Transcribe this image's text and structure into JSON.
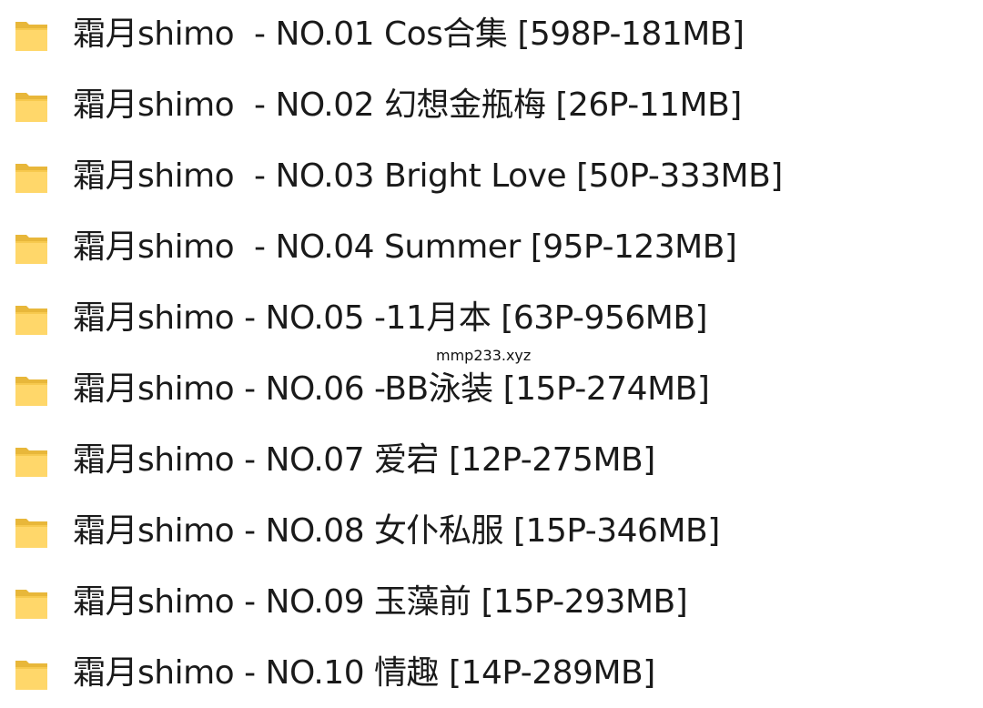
{
  "folders": [
    {
      "name": "霜月shimo  - NO.01 Cos合集 [598P-181MB]",
      "icon": "folder-icon"
    },
    {
      "name": "霜月shimo  - NO.02 幻想金瓶梅 [26P-11MB]",
      "icon": "folder-icon"
    },
    {
      "name": "霜月shimo  - NO.03 Bright Love [50P-333MB]",
      "icon": "folder-icon"
    },
    {
      "name": "霜月shimo  - NO.04 Summer [95P-123MB]",
      "icon": "folder-icon"
    },
    {
      "name": "霜月shimo - NO.05 -11月本 [63P-956MB]",
      "icon": "folder-icon"
    },
    {
      "name": "霜月shimo - NO.06 -BB泳装 [15P-274MB]",
      "icon": "folder-icon"
    },
    {
      "name": "霜月shimo - NO.07 爱宕 [12P-275MB]",
      "icon": "folder-icon"
    },
    {
      "name": "霜月shimo - NO.08 女仆私服 [15P-346MB]",
      "icon": "folder-icon"
    },
    {
      "name": "霜月shimo - NO.09 玉藻前 [15P-293MB]",
      "icon": "folder-icon"
    },
    {
      "name": "霜月shimo - NO.10 情趣 [14P-289MB]",
      "icon": "folder-icon"
    }
  ],
  "watermark": "mmp233.xyz",
  "colors": {
    "folder_back": "#e8b73a",
    "folder_front": "#ffd76a",
    "folder_edge": "#f7c94e",
    "text": "#1a1a1a",
    "background": "#ffffff"
  }
}
